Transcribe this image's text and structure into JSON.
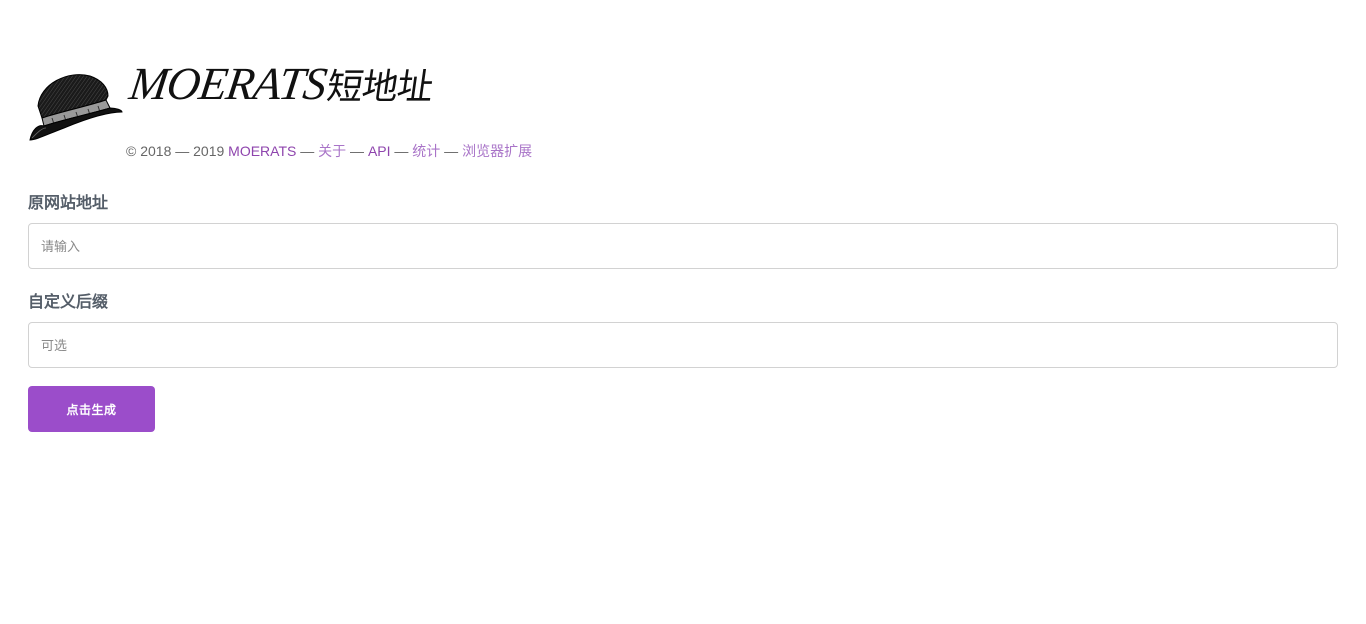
{
  "brand": {
    "title_latin": "MOERATS",
    "title_cjk": "短地址"
  },
  "footer": {
    "copyright": "© 2018 — 2019 ",
    "links": [
      {
        "label": "MOERATS"
      },
      {
        "label": "关于"
      },
      {
        "label": "API"
      },
      {
        "label": "统计"
      },
      {
        "label": "浏览器扩展"
      }
    ],
    "separator": " — "
  },
  "form": {
    "url_label": "原网站地址",
    "url_placeholder": "请输入",
    "url_value": "",
    "suffix_label": "自定义后缀",
    "suffix_placeholder": "可选",
    "suffix_value": "",
    "submit_label": "点击生成"
  },
  "colors": {
    "accent": "#9b4dca",
    "link": "#8e44ad",
    "label": "#555e69"
  },
  "icons": {
    "logo": "bowler-hat-icon"
  }
}
